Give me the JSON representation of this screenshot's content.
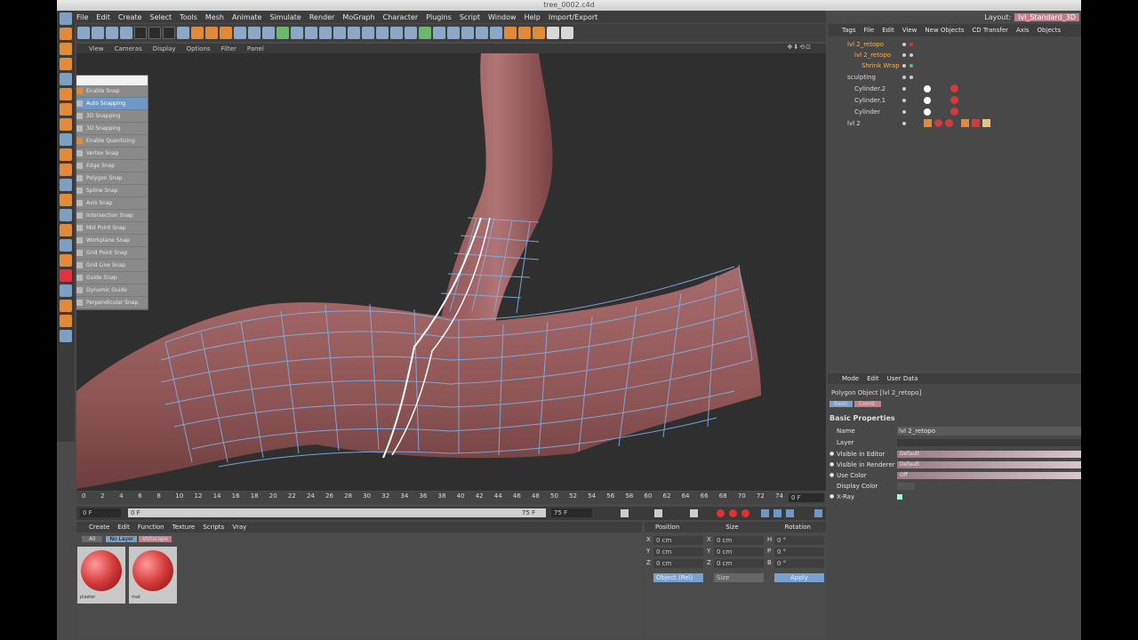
{
  "window": {
    "title": "tree_0002.c4d"
  },
  "menu": [
    "File",
    "Edit",
    "Create",
    "Select",
    "Tools",
    "Mesh",
    "Animate",
    "Simulate",
    "Render",
    "MoGraph",
    "Character",
    "Plugins",
    "Script",
    "Window",
    "Help",
    "Import/Export"
  ],
  "layout": {
    "label": "Layout:",
    "value": "lvl_Standard_3D"
  },
  "viewport": {
    "menu": [
      "View",
      "Cameras",
      "Display",
      "Options",
      "Filter",
      "Panel"
    ],
    "nav_icons": "✥⬇⟲⊡"
  },
  "snap_menu": [
    "Enable Snap",
    "Auto Snapping",
    "3D Snapping",
    "3D Snapping",
    "Enable Quantizing",
    "Vertex Snap",
    "Edge Snap",
    "Polygon Snap",
    "Spline Snap",
    "Axis Snap",
    "Intersection Snap",
    "Mid Point Snap",
    "Workplane Snap",
    "Grid Point Snap",
    "Grid Line Snap",
    "Guide Snap",
    "Dynamic Guide",
    "Perpendicular Snap"
  ],
  "timeline": {
    "ticks": [
      "0",
      "2",
      "4",
      "6",
      "8",
      "10",
      "12",
      "14",
      "16",
      "18",
      "20",
      "22",
      "24",
      "26",
      "28",
      "30",
      "32",
      "34",
      "36",
      "38",
      "40",
      "42",
      "44",
      "46",
      "48",
      "50",
      "52",
      "54",
      "56",
      "58",
      "60",
      "62",
      "64",
      "66",
      "68",
      "70",
      "72",
      "74"
    ],
    "current_frame": "0 F",
    "start": "0 F",
    "range_start": "0 F",
    "range_end": "75 F",
    "end": "75 F"
  },
  "material_panel": {
    "menu": [
      "Create",
      "Edit",
      "Function",
      "Texture",
      "Scripts",
      "Vray"
    ],
    "filters": [
      "All",
      "No Layer",
      "shitscape"
    ],
    "materials": [
      {
        "name": "plaster"
      },
      {
        "name": "mat"
      }
    ]
  },
  "coord_panel": {
    "headers": [
      "Position",
      "Size",
      "Rotation"
    ],
    "rows": [
      {
        "axis": "X",
        "pos": "0 cm",
        "size_axis": "X",
        "size": "0 cm",
        "rot_axis": "H",
        "rot": "0 °"
      },
      {
        "axis": "Y",
        "pos": "0 cm",
        "size_axis": "Y",
        "size": "0 cm",
        "rot_axis": "P",
        "rot": "0 °"
      },
      {
        "axis": "Z",
        "pos": "0 cm",
        "size_axis": "Z",
        "size": "0 cm",
        "rot_axis": "B",
        "rot": "0 °"
      }
    ],
    "mode": "Object (Rel)",
    "size_mode": "Size",
    "apply": "Apply"
  },
  "objects_panel": {
    "menu": [
      "Tags",
      "File",
      "Edit",
      "View",
      "New Objects",
      "CD Transfer",
      "Axis",
      "Objects"
    ],
    "items": [
      {
        "name": "lvl 2_retopo",
        "indent": 0,
        "active": true
      },
      {
        "name": "lvl 2_retopo",
        "indent": 1,
        "active": true
      },
      {
        "name": "Shrink Wrap",
        "indent": 2,
        "active": true
      },
      {
        "name": "sculpting",
        "indent": 0,
        "active": false
      },
      {
        "name": "Cylinder.2",
        "indent": 1,
        "active": false
      },
      {
        "name": "Cylinder.1",
        "indent": 1,
        "active": false
      },
      {
        "name": "Cylinder",
        "indent": 1,
        "active": false
      },
      {
        "name": "lvl 2",
        "indent": 0,
        "active": false
      }
    ]
  },
  "attributes_panel": {
    "menu": [
      "Mode",
      "Edit",
      "User Data"
    ],
    "title": "Polygon Object [lvl 2_retopo]",
    "tabs": [
      "Basic",
      "Coord."
    ],
    "section": "Basic Properties",
    "fields": [
      {
        "label": "Name",
        "value": "lvl 2_retopo"
      },
      {
        "label": "Layer",
        "value": ""
      },
      {
        "label": "Visible in Editor",
        "value": "Default"
      },
      {
        "label": "Visible in Renderer",
        "value": "Default"
      },
      {
        "label": "Use Color",
        "value": "Off"
      },
      {
        "label": "Display Color",
        "value": ""
      },
      {
        "label": "X-Ray",
        "value": ""
      }
    ]
  },
  "colors": {
    "accent_orange": "#ffb14a",
    "mesh_wire": "#7fb0e6",
    "material": "#d43a3a"
  }
}
